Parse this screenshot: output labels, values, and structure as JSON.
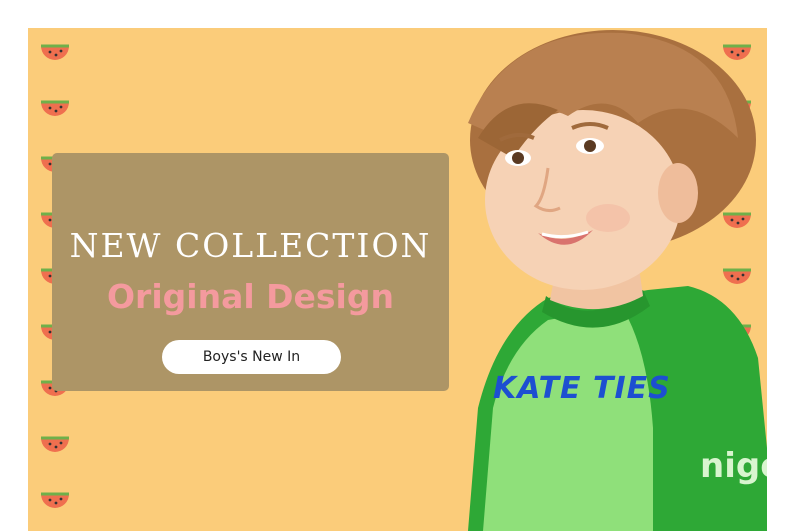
{
  "banner": {
    "heading": "NEW COLLECTION",
    "subheading": "Original Design",
    "cta_label": "Boys's New In",
    "shirt_print_text": "KATE TIES",
    "sleeve_print_text": "nigo",
    "icons": {
      "pattern": "watermelon-slice-icon"
    },
    "colors": {
      "background": "#fbcc7a",
      "panel": "#ad9566",
      "heading": "#ffffff",
      "subheading": "#f49a9e",
      "button": "#ffffff",
      "shirt": "#2ea836",
      "shirt_print": "#1d4fd1"
    }
  }
}
